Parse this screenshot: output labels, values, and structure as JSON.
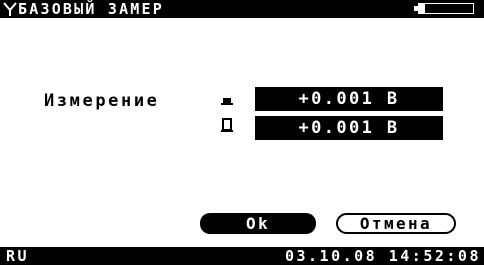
{
  "titlebar": {
    "title": "БАЗОВЫЙ ЗАМЕР",
    "left_icon": "antenna-icon",
    "battery_icon": "battery-icon",
    "battery_level": 0.12
  },
  "measurement": {
    "label": "Измерение",
    "rows": [
      {
        "icon": "probe-up-icon",
        "value": "+0.001 В"
      },
      {
        "icon": "probe-down-icon",
        "value": "+0.001 В"
      }
    ]
  },
  "buttons": {
    "ok_label": "Ok",
    "cancel_label": "Отмена"
  },
  "statusbar": {
    "language": "RU",
    "datetime": "03.10.08 14:52:08"
  }
}
